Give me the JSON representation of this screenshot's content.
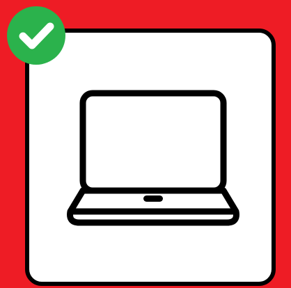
{
  "colors": {
    "background": "#ee1c25",
    "card": "#ffffff",
    "outline": "#000000",
    "badge": "#2bb24c",
    "badge_mark": "#ffffff"
  },
  "icons": {
    "main": "laptop-icon",
    "badge": "checkmark-icon"
  }
}
